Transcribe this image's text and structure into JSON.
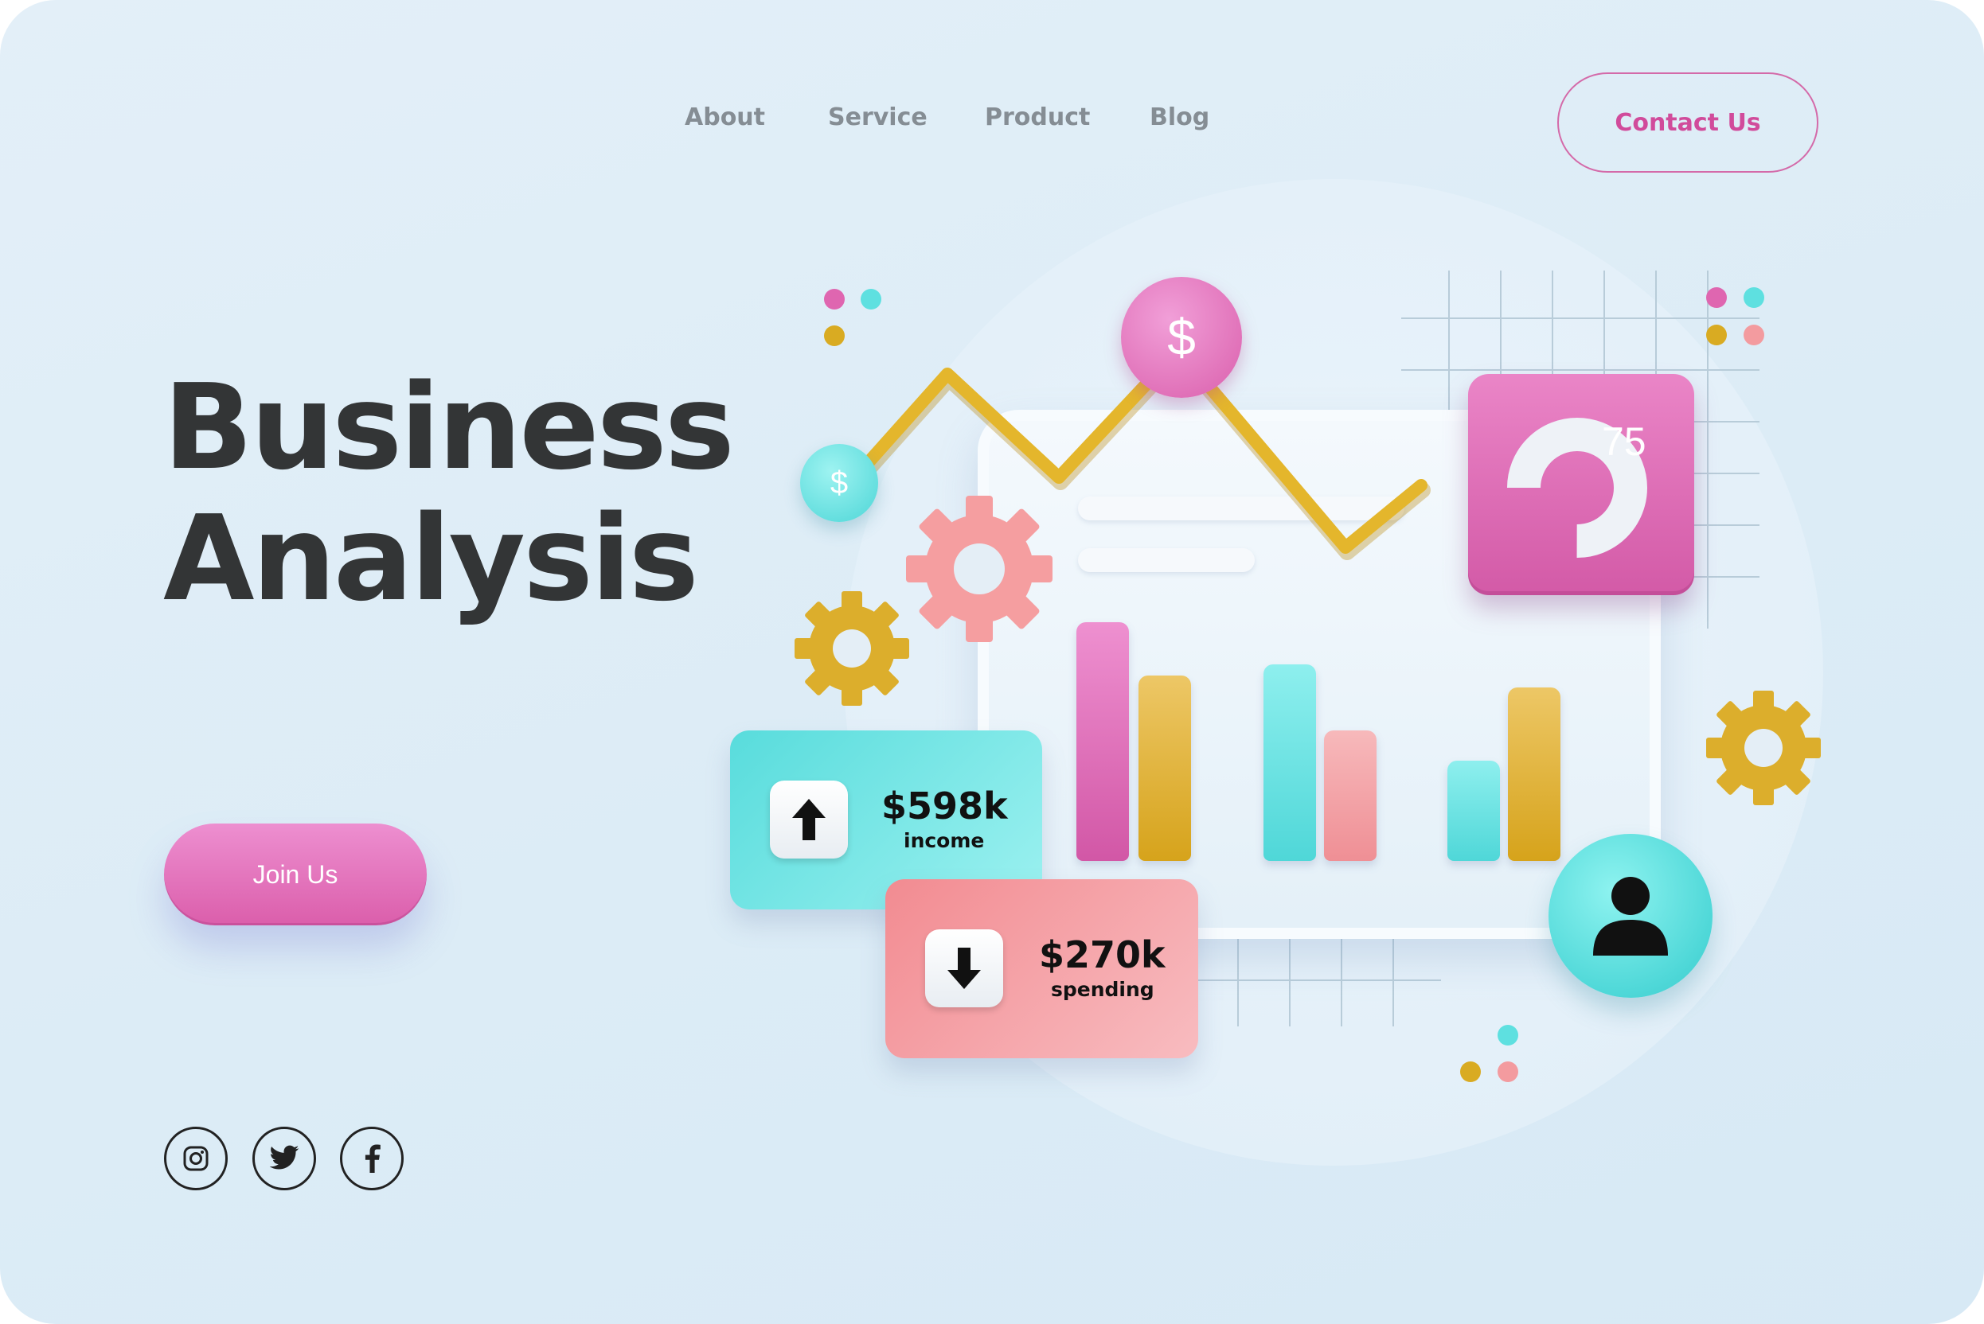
{
  "nav": {
    "items": [
      {
        "label": "About"
      },
      {
        "label": "Service"
      },
      {
        "label": "Product"
      },
      {
        "label": "Blog"
      }
    ],
    "contact_label": "Contact Us"
  },
  "hero": {
    "title_line1": "Business",
    "title_line2": "Analysis",
    "cta_label": "Join Us"
  },
  "social": [
    "instagram-icon",
    "twitter-icon",
    "facebook-icon"
  ],
  "illustration": {
    "coin_symbol": "$",
    "pie_value": "75",
    "income": {
      "value": "$598k",
      "label": "income",
      "direction": "up"
    },
    "spending": {
      "value": "$270k",
      "label": "spending",
      "direction": "down"
    }
  },
  "colors": {
    "pink": "#df66b0",
    "cyan": "#5ee0e0",
    "gold": "#d9ab22",
    "salmon": "#f39b9f",
    "text_dark": "#333536",
    "nav_gray": "#858d94"
  }
}
